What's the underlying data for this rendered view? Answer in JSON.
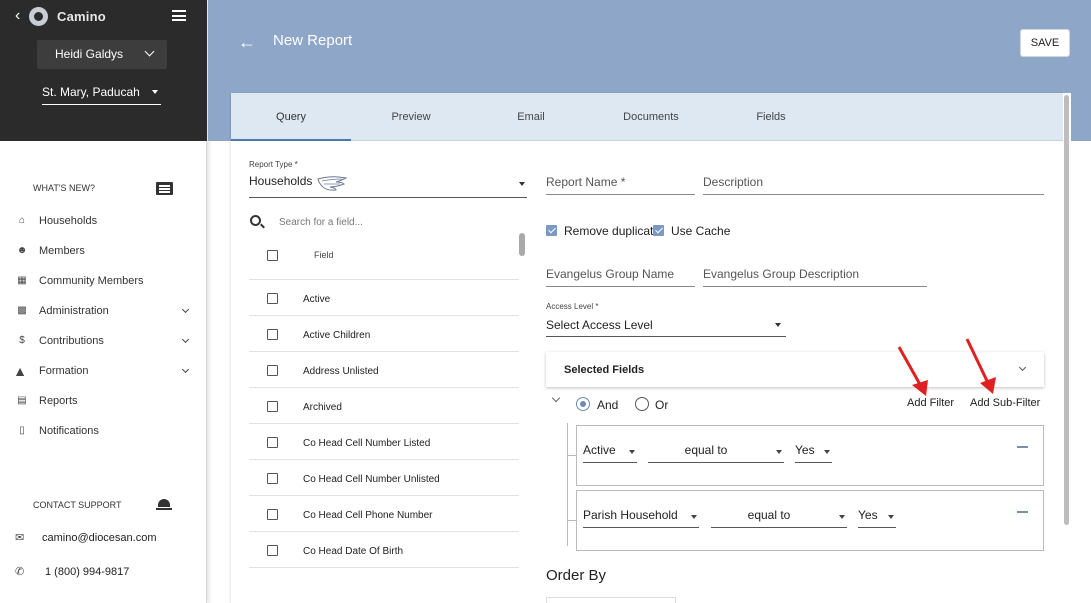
{
  "sidebar": {
    "app_name": "Camino",
    "user": "Heidi Galdys",
    "parish": "St. Mary, Paducah",
    "whats_new": "WHAT'S NEW?",
    "nav": [
      {
        "label": "Households"
      },
      {
        "label": "Members"
      },
      {
        "label": "Community Members"
      },
      {
        "label": "Administration"
      },
      {
        "label": "Contributions"
      },
      {
        "label": "Formation"
      },
      {
        "label": "Reports"
      },
      {
        "label": "Notifications"
      }
    ],
    "contact_support": "CONTACT SUPPORT",
    "email": "camino@diocesan.com",
    "phone": "1 (800) 994-9817"
  },
  "header": {
    "title": "New Report",
    "save_label": "SAVE"
  },
  "tabs": [
    {
      "label": "Query"
    },
    {
      "label": "Preview"
    },
    {
      "label": "Email"
    },
    {
      "label": "Documents"
    },
    {
      "label": "Fields"
    }
  ],
  "query": {
    "report_type_label": "Report Type *",
    "report_type_value": "Households",
    "search_placeholder": "Search for a field...",
    "field_column_header": "Field",
    "fields": [
      {
        "name": "Active"
      },
      {
        "name": "Active Children"
      },
      {
        "name": "Address Unlisted"
      },
      {
        "name": "Archived"
      },
      {
        "name": "Co Head Cell Number Listed"
      },
      {
        "name": "Co Head Cell Number Unlisted"
      },
      {
        "name": "Co Head Cell Phone Number"
      },
      {
        "name": "Co Head Date Of Birth"
      }
    ],
    "report_name_placeholder": "Report Name *",
    "description_placeholder": "Description",
    "remove_duplicates_label": "Remove duplicates",
    "use_cache_label": "Use Cache",
    "evangelus_group_name_placeholder": "Evangelus Group Name",
    "evangelus_group_description_placeholder": "Evangelus Group Description",
    "access_level_label": "Access Level *",
    "access_level_value": "Select Access Level",
    "selected_fields_label": "Selected Fields",
    "logic_and_label": "And",
    "logic_or_label": "Or",
    "add_filter_label": "Add Filter",
    "add_sub_filter_label": "Add Sub-Filter",
    "filters": [
      {
        "field": "Active",
        "operator": "equal to",
        "value": "Yes"
      },
      {
        "field": "Parish Household",
        "operator": "equal to",
        "value": "Yes"
      }
    ],
    "order_by_label": "Order By"
  },
  "colors": {
    "sidebar_dark": "#2b2b2b",
    "header_blue": "#8ea6c7",
    "tab_bar": "#dde8f2",
    "accent": "#6d8bb5",
    "annotation_red": "#e02020"
  }
}
